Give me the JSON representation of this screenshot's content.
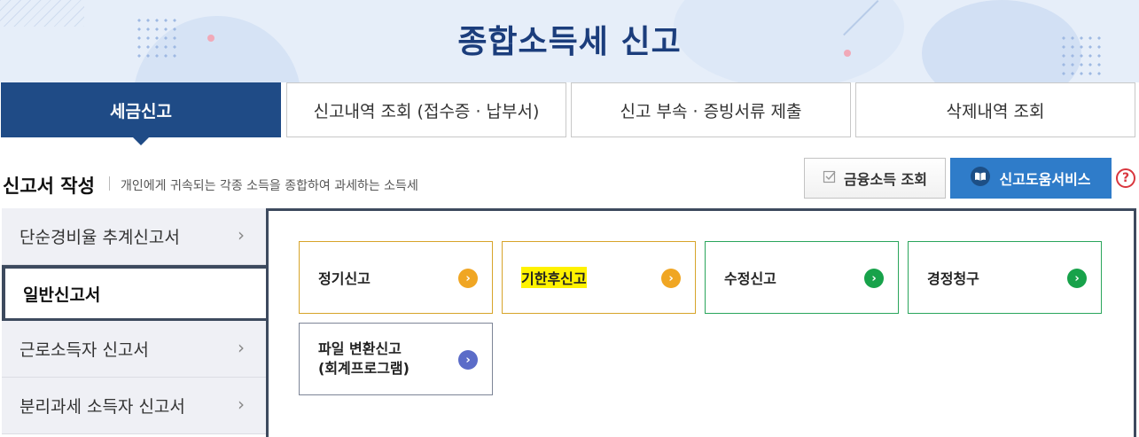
{
  "page_title": "종합소득세  신고",
  "top_tabs": [
    {
      "label": "세금신고",
      "active": true
    },
    {
      "label": "신고내역 조회 (접수증 · 납부서)",
      "active": false
    },
    {
      "label": "신고 부속 · 증빙서류 제출",
      "active": false
    },
    {
      "label": "삭제내역 조회",
      "active": false
    }
  ],
  "section": {
    "title": "신고서 작성",
    "description": "개인에게 귀속되는 각종 소득을 종합하여 과세하는 소득세"
  },
  "buttons": {
    "finance_lookup": "금융소득 조회",
    "help_service": "신고도움서비스",
    "help_question": "?"
  },
  "side_nav": [
    {
      "label": "단순경비율 추계신고서",
      "active": false
    },
    {
      "label": "일반신고서",
      "active": true
    },
    {
      "label": "근로소득자 신고서",
      "active": false
    },
    {
      "label": "분리과세 소득자 신고서",
      "active": false
    }
  ],
  "chevron_glyph": "›",
  "arrow_glyph": "›",
  "cards": [
    {
      "label": "정기신고",
      "color": "#f0a623",
      "highlighted": false
    },
    {
      "label": "기한후신고",
      "color": "#f0a623",
      "highlighted": true
    },
    {
      "label": "수정신고",
      "color": "#17a24a",
      "highlighted": false
    },
    {
      "label": "경정청구",
      "color": "#17a24a",
      "highlighted": false
    },
    {
      "label_line1": "파일 변환신고",
      "label_line2": "(회계프로그램)",
      "color": "#5b6cc8",
      "highlighted": false
    }
  ],
  "colors": {
    "primary": "#1f4b86",
    "help_button": "#2f7cc9",
    "title": "#1b3d7c",
    "highlight": "#fff200"
  }
}
